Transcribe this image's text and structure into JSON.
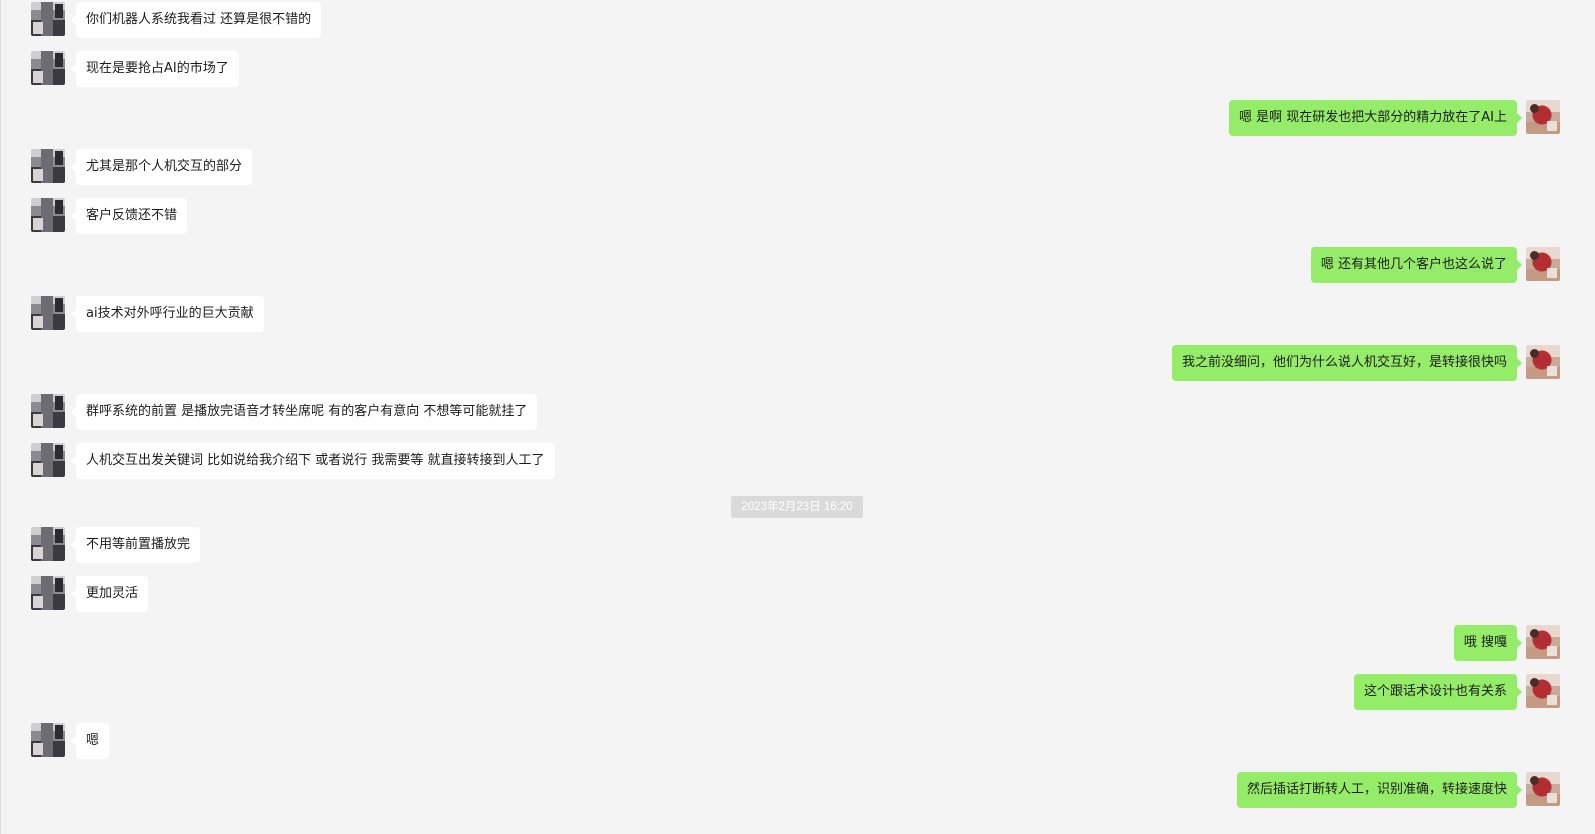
{
  "window": {
    "type": "chat"
  },
  "participants": {
    "contact": {
      "avatar_icon": "contact-avatar-icon"
    },
    "self": {
      "avatar_icon": "self-avatar-icon"
    }
  },
  "colors": {
    "background": "#f4f4f4",
    "incoming_bubble": "#ffffff",
    "outgoing_bubble": "#95ec69",
    "timestamp_bg": "#dadada",
    "timestamp_text": "#ffffff"
  },
  "messages": [
    {
      "kind": "message",
      "side": "left",
      "text": "你们机器人系统我看过 还算是很不错的"
    },
    {
      "kind": "message",
      "side": "left",
      "text": "现在是要抢占AI的市场了"
    },
    {
      "kind": "message",
      "side": "right",
      "text": "嗯 是啊 现在研发也把大部分的精力放在了AI上"
    },
    {
      "kind": "message",
      "side": "left",
      "text": "尤其是那个人机交互的部分"
    },
    {
      "kind": "message",
      "side": "left",
      "text": "客户反馈还不错"
    },
    {
      "kind": "message",
      "side": "right",
      "text": "嗯  还有其他几个客户也这么说了"
    },
    {
      "kind": "message",
      "side": "left",
      "text": "ai技术对外呼行业的巨大贡献"
    },
    {
      "kind": "message",
      "side": "right",
      "text": "我之前没细问，他们为什么说人机交互好，是转接很快吗"
    },
    {
      "kind": "message",
      "side": "left",
      "text": "群呼系统的前置 是播放完语音才转坐席呢 有的客户有意向 不想等可能就挂了"
    },
    {
      "kind": "message",
      "side": "left",
      "text": "人机交互出发关键词 比如说给我介绍下 或者说行 我需要等 就直接转接到人工了"
    },
    {
      "kind": "timestamp",
      "text": "2023年2月23日 16:20"
    },
    {
      "kind": "message",
      "side": "left",
      "text": "不用等前置播放完"
    },
    {
      "kind": "message",
      "side": "left",
      "text": "更加灵活"
    },
    {
      "kind": "message",
      "side": "right",
      "text": "哦  搜嘎"
    },
    {
      "kind": "message",
      "side": "right",
      "text": "这个跟话术设计也有关系"
    },
    {
      "kind": "message",
      "side": "left",
      "text": "嗯"
    },
    {
      "kind": "message",
      "side": "right",
      "text": "然后插话打断转人工，识别准确，转接速度快"
    }
  ]
}
